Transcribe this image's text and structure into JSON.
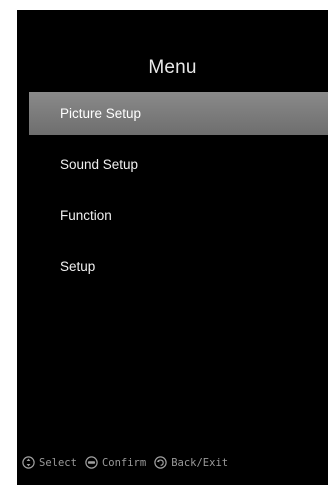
{
  "menu": {
    "title": "Menu",
    "items": [
      {
        "label": "Picture Setup",
        "selected": true
      },
      {
        "label": "Sound Setup",
        "selected": false
      },
      {
        "label": "Function",
        "selected": false
      },
      {
        "label": "Setup",
        "selected": false
      }
    ]
  },
  "footer": {
    "hints": [
      {
        "icon": "updown-dpad-icon",
        "label": "Select"
      },
      {
        "icon": "enter-button-icon",
        "label": "Confirm"
      },
      {
        "icon": "back-arrow-icon",
        "label": "Back/Exit"
      }
    ]
  },
  "colors": {
    "background": "#000000",
    "selected_bar": "#7c7c7c",
    "text": "#f0f0f0",
    "hint_text": "#9a9a9a"
  }
}
